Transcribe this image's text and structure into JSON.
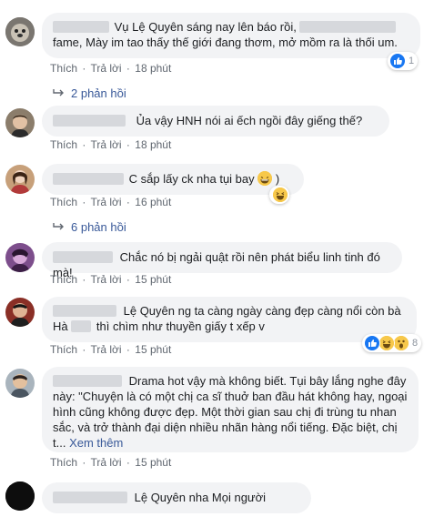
{
  "actions": {
    "like": "Thích",
    "reply": "Trả lời",
    "dot": "·"
  },
  "comments": [
    {
      "text_line1": "Vụ Lệ Quyên sáng nay lên báo rồi,",
      "text_line2": "fame, Mày im tao thấy thế giới đang thơm, mở mồm ra là thối um.",
      "time": "18 phút",
      "reaction_count": "1",
      "replies_label": "2 phản hồi"
    },
    {
      "text": "Ủa vậy HNH nói ai ếch ngồi đây giếng thế?",
      "time": "18 phút"
    },
    {
      "text": "C sắp lấy ck nha tụi bay",
      "text_suffix": ")",
      "time": "16 phút",
      "replies_label": "6 phản hồi"
    },
    {
      "text": "Chắc nó bị ngải quật rồi nên phát biểu linh tinh đó mà!",
      "time": "15 phút"
    },
    {
      "text_line1": "Lệ Quyên ng ta càng ngày càng đẹp càng nổi còn bà",
      "text_line2_a": "Hà",
      "text_line2_b": "thì chìm như thuyền giấy t xếp v",
      "time": "15 phút",
      "reaction_count": "8"
    },
    {
      "text_line1": "Drama hot vậy mà không biết. Tụi bây lắng nghe đây",
      "text_line2": "này: \"Chuyện là có một chị ca sĩ thuở ban đầu hát không hay, ngoại",
      "text_line3": "hình cũng không được đẹp. Một thời gian sau chị đi trùng tu nhan",
      "text_line4": "sắc, và trở thành đại diện nhiều nhãn hàng nổi tiếng. Đặc biệt, chị",
      "text_line5": "t...",
      "see_more": "Xem thêm",
      "time": "15 phút"
    },
    {
      "text": "Lệ Quyên nha Mọi người"
    }
  ]
}
